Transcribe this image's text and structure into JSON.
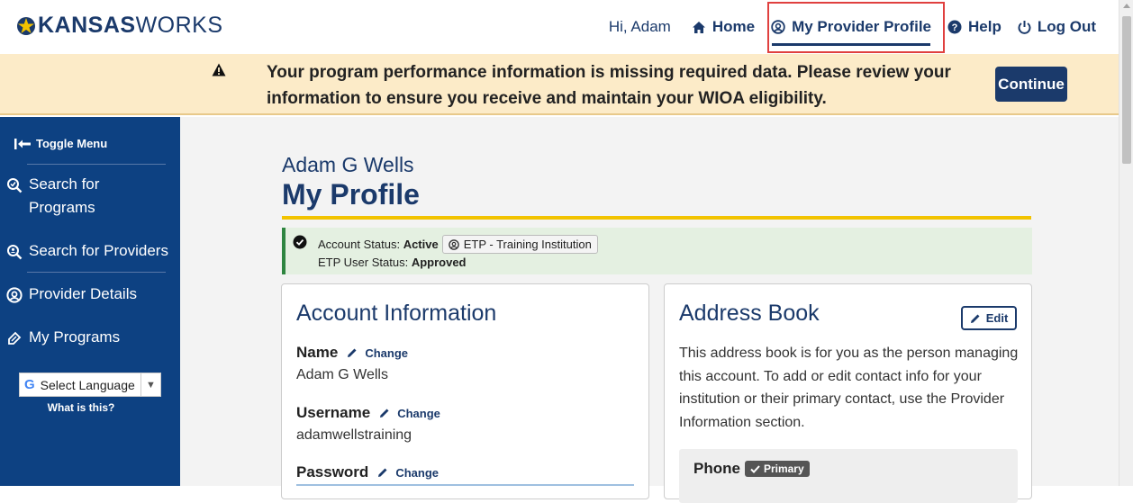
{
  "brand": {
    "logo_bold": "KANSAS",
    "logo_thin": "WORKS"
  },
  "nav": {
    "greeting": "Hi, Adam",
    "home": "Home",
    "profile": "My Provider Profile",
    "help": "Help",
    "logout": "Log Out"
  },
  "banner": {
    "message": "Your program performance information is missing required data. Please review your information to ensure you receive and maintain your WIOA eligibility.",
    "button": "Continue"
  },
  "sidebar": {
    "toggle": "Toggle Menu",
    "items": [
      {
        "label": "Search for Programs",
        "icon": "search-programs-icon"
      },
      {
        "label": "Search for Providers",
        "icon": "search-providers-icon"
      },
      {
        "label": "Provider Details",
        "icon": "provider-icon"
      },
      {
        "label": "My Programs",
        "icon": "programs-icon"
      }
    ],
    "language_select": "Select Language",
    "language_help": "What is this?"
  },
  "profile": {
    "user_name": "Adam G Wells",
    "title": "My Profile",
    "status": {
      "account_label": "Account Status:",
      "account_value": "Active",
      "chip": "ETP - Training Institution",
      "etp_label": "ETP User Status:",
      "etp_value": "Approved"
    }
  },
  "account": {
    "heading": "Account Information",
    "change": "Change",
    "fields": [
      {
        "label": "Name",
        "value": "Adam G Wells"
      },
      {
        "label": "Username",
        "value": "adamwellstraining"
      },
      {
        "label": "Password",
        "value": ""
      }
    ]
  },
  "address": {
    "heading": "Address Book",
    "edit": "Edit",
    "description": "This address book is for you as the person managing this account. To add or edit contact info for your institution or their primary contact, use the Provider Information section.",
    "phone_label": "Phone",
    "primary_badge": "Primary"
  },
  "colors": {
    "brand_blue": "#1b3a6b",
    "sidebar_blue": "#0d4182",
    "banner_bg": "#fcebc8",
    "accent_gold": "#f2c300",
    "success_green": "#2e8540"
  }
}
